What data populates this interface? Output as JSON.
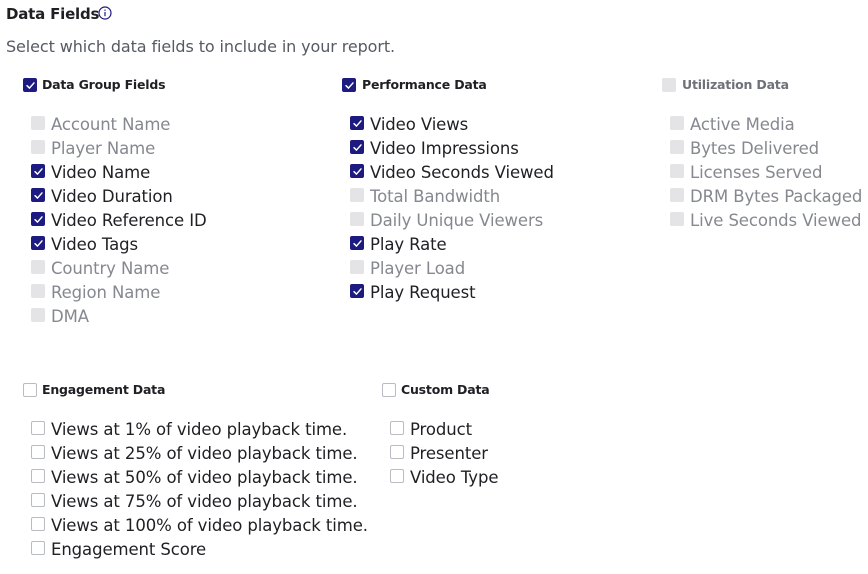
{
  "header": {
    "title": "Data Fields",
    "subtitle": "Select which data fields to include in your report."
  },
  "colors": {
    "checked": "#1d1a80",
    "disabled": "#e4e4e7",
    "unchecked_border": "#b9bcc2"
  },
  "groups": [
    {
      "id": "data-group-fields",
      "label": "Data Group Fields",
      "state": "checked",
      "items": [
        {
          "label": "Account Name",
          "state": "disabled"
        },
        {
          "label": "Player Name",
          "state": "disabled"
        },
        {
          "label": "Video Name",
          "state": "checked"
        },
        {
          "label": "Video Duration",
          "state": "checked"
        },
        {
          "label": "Video Reference ID",
          "state": "checked"
        },
        {
          "label": "Video Tags",
          "state": "checked"
        },
        {
          "label": "Country Name",
          "state": "disabled"
        },
        {
          "label": "Region Name",
          "state": "disabled"
        },
        {
          "label": "DMA",
          "state": "disabled"
        }
      ]
    },
    {
      "id": "performance-data",
      "label": "Performance Data",
      "state": "checked",
      "items": [
        {
          "label": "Video Views",
          "state": "checked"
        },
        {
          "label": "Video Impressions",
          "state": "checked"
        },
        {
          "label": "Video Seconds Viewed",
          "state": "checked"
        },
        {
          "label": "Total Bandwidth",
          "state": "disabled"
        },
        {
          "label": "Daily Unique Viewers",
          "state": "disabled"
        },
        {
          "label": "Play Rate",
          "state": "checked"
        },
        {
          "label": "Player Load",
          "state": "disabled"
        },
        {
          "label": "Play Request",
          "state": "checked"
        }
      ]
    },
    {
      "id": "utilization-data",
      "label": "Utilization Data",
      "state": "disabled",
      "items": [
        {
          "label": "Active Media",
          "state": "disabled"
        },
        {
          "label": "Bytes Delivered",
          "state": "disabled"
        },
        {
          "label": "Licenses Served",
          "state": "disabled"
        },
        {
          "label": "DRM Bytes Packaged",
          "state": "disabled"
        },
        {
          "label": "Live Seconds Viewed",
          "state": "disabled"
        }
      ]
    },
    {
      "id": "engagement-data",
      "label": "Engagement Data",
      "state": "unchecked",
      "items": [
        {
          "label": "Views at 1% of video playback time.",
          "state": "unchecked"
        },
        {
          "label": "Views at 25% of video playback time.",
          "state": "unchecked"
        },
        {
          "label": "Views at 50% of video playback time.",
          "state": "unchecked"
        },
        {
          "label": "Views at 75% of video playback time.",
          "state": "unchecked"
        },
        {
          "label": "Views at 100% of video playback time.",
          "state": "unchecked"
        },
        {
          "label": "Engagement Score",
          "state": "unchecked"
        }
      ]
    },
    {
      "id": "custom-data",
      "label": "Custom Data",
      "state": "unchecked",
      "items": [
        {
          "label": "Product",
          "state": "unchecked"
        },
        {
          "label": "Presenter",
          "state": "unchecked"
        },
        {
          "label": "Video Type",
          "state": "unchecked"
        }
      ]
    }
  ]
}
